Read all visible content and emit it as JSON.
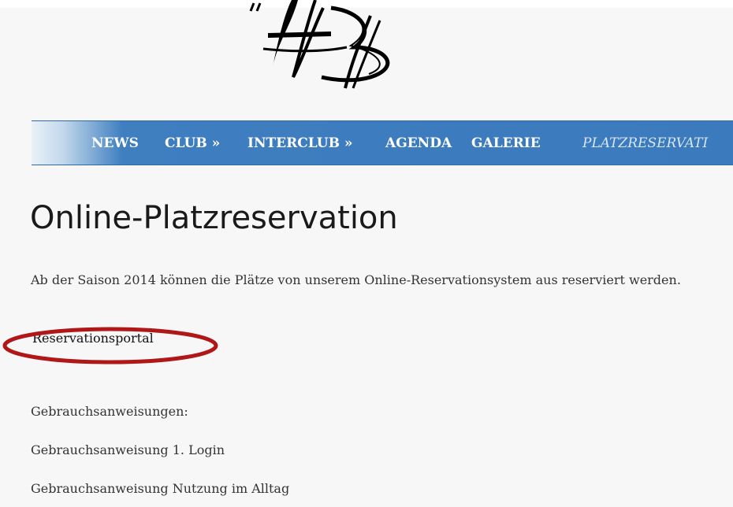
{
  "nav": {
    "items": [
      {
        "label": "NEWS"
      },
      {
        "label": "CLUB »"
      },
      {
        "label": "INTERCLUB »"
      },
      {
        "label": "AGENDA"
      },
      {
        "label": "GALERIE"
      },
      {
        "label": "PLATZRESERVATI"
      }
    ],
    "current": "PLATZRESERVATI"
  },
  "main": {
    "title": "Online-Platzreservation",
    "intro": "Ab der Saison 2014 können die Plätze von unserem Online-Reservationsystem aus reserviert werden.",
    "portal_link": "Reservationsportal",
    "manuals_heading": "Gebrauchsanweisungen:",
    "manuals": [
      {
        "label": "Gebrauchsanweisung 1. Login"
      },
      {
        "label": "Gebrauchsanweisung Nutzung im Alltag"
      }
    ]
  },
  "colors": {
    "nav_blue": "#3a7abd",
    "highlight_red": "#b01818",
    "page_background": "#f7f7f7"
  }
}
